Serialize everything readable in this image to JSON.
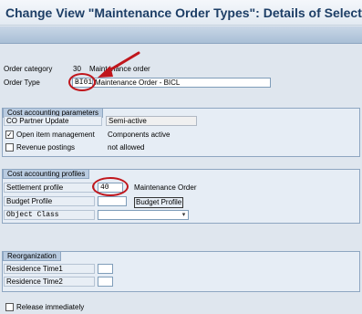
{
  "title": "Change View \"Maintenance Order Types\": Details of Selected",
  "header": {
    "order_category_label": "Order category",
    "order_category_value": "30",
    "order_category_text": "Maintenance order",
    "order_type_label": "Order Type",
    "order_type_value": "BI01",
    "order_type_text": "Maintenance Order - BICL"
  },
  "cost_accounting": {
    "title": "Cost accounting parameters",
    "co_partner_label": "CO Partner Update",
    "co_partner_value": "Semi-active",
    "open_item_label": "Open item management",
    "open_item_checked": true,
    "open_item_text": "Components active",
    "revenue_label": "Revenue postings",
    "revenue_checked": false,
    "revenue_text": "not allowed"
  },
  "profiles": {
    "title": "Cost accounting profiles",
    "settlement_label": "Settlement profile",
    "settlement_value": "40",
    "settlement_text": "Maintenance Order",
    "budget_label": "Budget Profile",
    "budget_value": "",
    "budget_text": "Budget Profile",
    "object_class_label": "Object Class",
    "object_class_value": ""
  },
  "reorganization": {
    "title": "Reorganization",
    "res1_label": "Residence Time1",
    "res1_value": "",
    "res2_label": "Residence Time2",
    "res2_value": ""
  },
  "release": {
    "label": "Release immediately",
    "checked": false
  },
  "icons": {
    "arrow": "red-arrow-icon",
    "checkmark": "✓",
    "dropdown": "▾"
  },
  "colors": {
    "annotation": "#c0161c",
    "title": "#1d3e66"
  }
}
